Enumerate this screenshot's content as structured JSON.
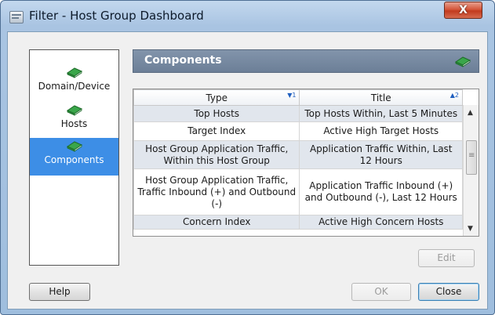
{
  "window": {
    "title": "Filter - Host Group Dashboard",
    "close_label": "X"
  },
  "nav": {
    "items": [
      {
        "label": "Domain/Device",
        "icon": "book-icon",
        "selected": false
      },
      {
        "label": "Hosts",
        "icon": "book-icon",
        "selected": false
      },
      {
        "label": "Components",
        "icon": "book-icon",
        "selected": true
      }
    ]
  },
  "panel": {
    "title": "Components",
    "icon": "book-icon"
  },
  "table": {
    "columns": [
      {
        "label": "Type",
        "sort": "▼1"
      },
      {
        "label": "Title",
        "sort": "▲2"
      }
    ],
    "rows": [
      {
        "type": "Top Hosts",
        "title": "Top Hosts Within, Last 5 Minutes"
      },
      {
        "type": "Target Index",
        "title": "Active High Target Hosts"
      },
      {
        "type": "Host Group Application Traffic, Within this Host Group",
        "title": "Application Traffic Within, Last 12 Hours"
      },
      {
        "type": "Host Group Application Traffic, Traffic Inbound (+) and Outbound (-)",
        "title": "Application Traffic Inbound (+) and Outbound (-), Last 12 Hours"
      },
      {
        "type": "Concern Index",
        "title": "Active High Concern Hosts"
      }
    ]
  },
  "buttons": {
    "edit": "Edit",
    "help": "Help",
    "ok": "OK",
    "close": "Close"
  },
  "colors": {
    "selection": "#3d8ee6",
    "panel_header": "#6c7f97",
    "book_green": "#3aa64a"
  }
}
